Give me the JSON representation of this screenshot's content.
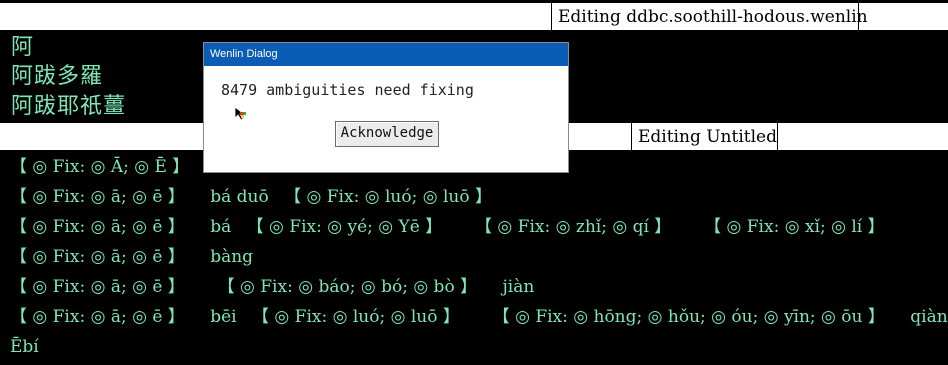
{
  "windows": {
    "top_title": "Editing  ddbc.soothill-hodous.wenlin",
    "mid_title": "Editing  Untitled"
  },
  "hanzi": [
    "阿",
    "阿跋多羅",
    "阿跋耶祇薑"
  ],
  "lines": [
    {
      "segs": [
        "【 ◎ Fix: ◎ Ā; ◎ Ē 】"
      ]
    },
    {
      "segs": [
        "【 ◎ Fix: ◎ ā; ◎ ē 】",
        "bá  duō",
        "【 ◎ Fix: ◎ luó; ◎ luō 】"
      ]
    },
    {
      "segs": [
        "【 ◎ Fix: ◎ ā; ◎ ē 】",
        "bá",
        "【 ◎ Fix: ◎ yé; ◎ Yē 】",
        "【 ◎ Fix: ◎ zhǐ; ◎ qí 】",
        "【 ◎ Fix: ◎ xǐ; ◎ lí 】"
      ]
    },
    {
      "segs": [
        "【 ◎ Fix: ◎ ā; ◎ ē 】",
        "bàng"
      ]
    },
    {
      "segs": [
        "【 ◎ Fix: ◎ ā; ◎ ē 】",
        "【 ◎ Fix: ◎ báo; ◎ bó; ◎ bò 】",
        "jiàn"
      ]
    },
    {
      "segs": [
        "【 ◎ Fix: ◎ ā; ◎ ē 】",
        "bēi",
        "【 ◎ Fix: ◎ luó; ◎ luō 】",
        "【 ◎ Fix: ◎ hōng; ◎ hǒu; ◎ óu; ◎ yīn; ◎ ōu 】",
        "qiàn"
      ]
    },
    {
      "segs": [
        "Ēbí"
      ]
    }
  ],
  "dialog": {
    "title": "Wenlin Dialog",
    "message": "8479 ambiguities need fixing",
    "button": "Acknowledge"
  },
  "colors": {
    "text": "#7fe6b6",
    "titlebar": "#0a5cb4",
    "background": "#000000"
  },
  "icons": {
    "cursor": "arrow-cursor-icon"
  }
}
